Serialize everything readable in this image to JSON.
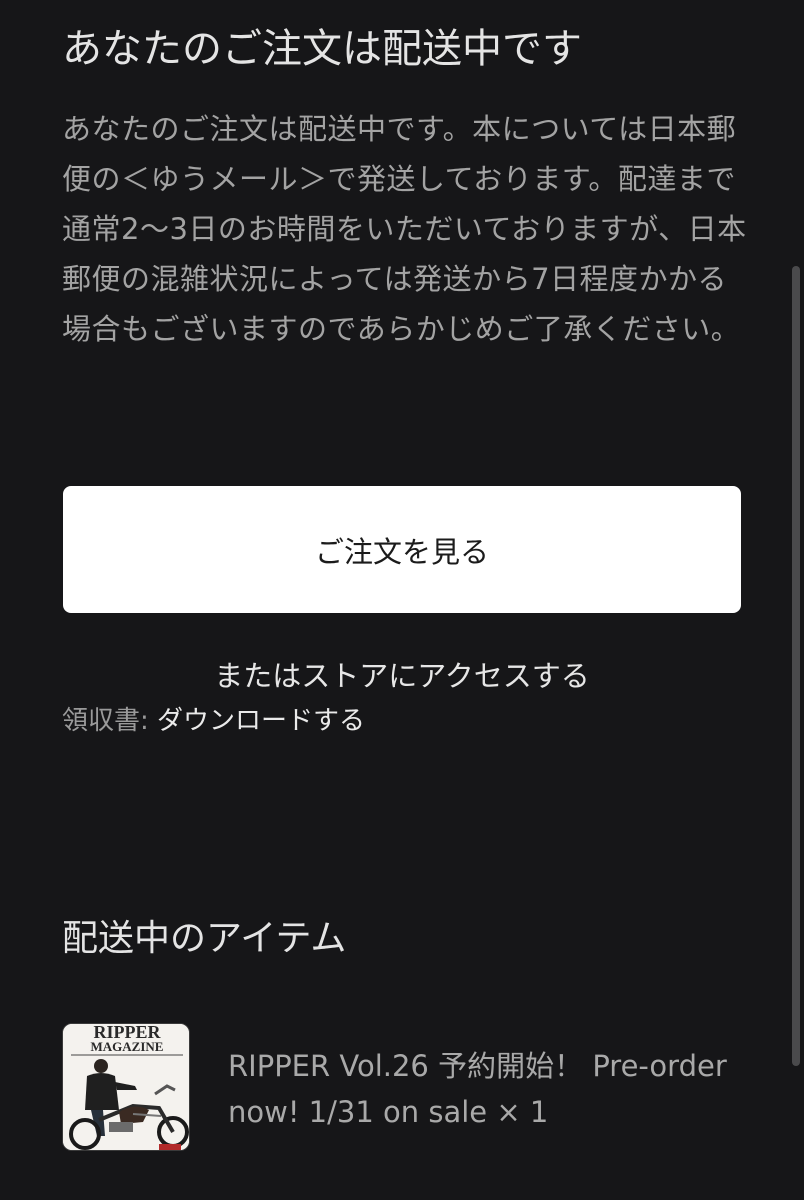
{
  "heading": "あなたのご注文は配送中です",
  "body_text": "あなたのご注文は配送中です。本については日本郵便の＜ゆうメール＞で発送しております。配達まで通常2〜3日のお時間をいただいておりますが、日本郵便の混雑状況によっては発送から7日程度かかる場合もございますのであらかじめご了承ください。",
  "view_order_button": "ご注文を見る",
  "store_link": "またはストアにアクセスする",
  "receipt": {
    "label": "領収書:",
    "link": "ダウンロードする"
  },
  "items_section": {
    "title": "配送中のアイテム",
    "items": [
      {
        "name": "RIPPER Vol.26 予約開始！ Pre-order now! 1/31 on sale",
        "quantity": "× 1",
        "thumbnail": {
          "masthead_top": "RIPPER",
          "masthead_bottom": "MAGAZINE"
        }
      }
    ]
  },
  "colors": {
    "background": "#161618",
    "button_background": "#ffffff",
    "body_text": "#a3a3a3",
    "heading_text": "#e4e4e4"
  }
}
